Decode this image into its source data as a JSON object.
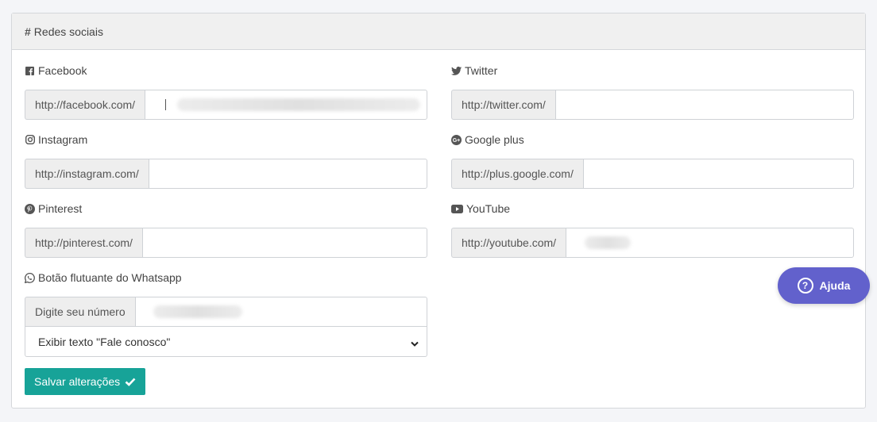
{
  "panel": {
    "title": "Redes sociais"
  },
  "facebook": {
    "label": "Facebook",
    "prefix": "http://facebook.com/",
    "value": ""
  },
  "twitter": {
    "label": "Twitter",
    "prefix": "http://twitter.com/",
    "value": ""
  },
  "instagram": {
    "label": "Instagram",
    "prefix": "http://instagram.com/",
    "value": ""
  },
  "googleplus": {
    "label": "Google plus",
    "prefix": "http://plus.google.com/",
    "value": ""
  },
  "pinterest": {
    "label": "Pinterest",
    "prefix": "http://pinterest.com/",
    "value": ""
  },
  "youtube": {
    "label": "YouTube",
    "prefix": "http://youtube.com/",
    "value": ""
  },
  "whatsapp": {
    "label": "Botão flutuante do Whatsapp",
    "prefix": "Digite seu número",
    "value": "",
    "select_value": "Exibir texto \"Fale conosco\""
  },
  "actions": {
    "save_label": "Salvar alterações"
  },
  "help": {
    "label": "Ajuda",
    "icon_glyph": "?"
  },
  "colors": {
    "save": "#17a398",
    "help": "#6261cc"
  }
}
